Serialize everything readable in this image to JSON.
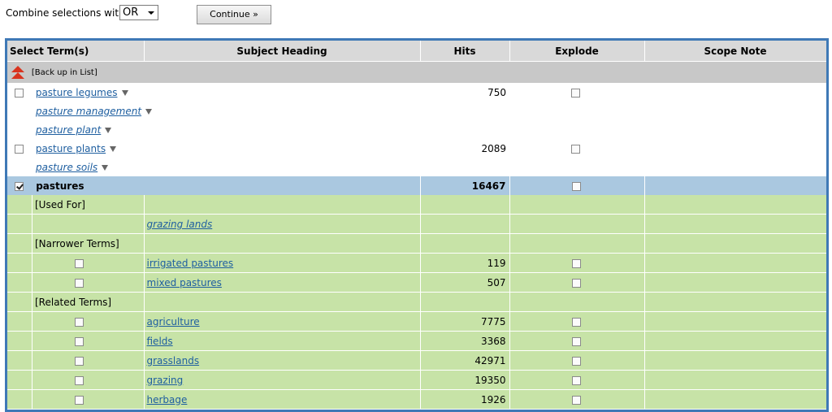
{
  "toolbar": {
    "combine_label": "Combine selections with:",
    "combine_value": "OR",
    "continue_label": "Continue »"
  },
  "table": {
    "headers": [
      "Select Term(s)",
      "Subject Heading",
      "Hits",
      "Explode",
      "Scope Note"
    ],
    "back_up_label": "[Back up in List]",
    "top_rows": [
      {
        "term": "pasture legumes",
        "hits": "750",
        "checkbox": true,
        "italic": false
      },
      {
        "term": "pasture management",
        "hits": "",
        "checkbox": false,
        "italic": true
      },
      {
        "term": "pasture plant",
        "hits": "",
        "checkbox": false,
        "italic": true
      },
      {
        "term": "pasture plants",
        "hits": "2089",
        "checkbox": true,
        "italic": false
      },
      {
        "term": "pasture soils",
        "hits": "",
        "checkbox": false,
        "italic": true
      }
    ],
    "selected_row": {
      "term": "pastures",
      "hits": "16467",
      "checked": true
    },
    "used_for_label": "[Used For]",
    "used_for": [
      {
        "term": "grazing lands"
      }
    ],
    "narrower_label": "[Narrower Terms]",
    "narrower": [
      {
        "term": "irrigated pastures",
        "hits": "119"
      },
      {
        "term": "mixed pastures",
        "hits": "507"
      }
    ],
    "related_label": "[Related Terms]",
    "related": [
      {
        "term": "agriculture",
        "hits": "7775"
      },
      {
        "term": "fields",
        "hits": "3368"
      },
      {
        "term": "grasslands",
        "hits": "42971"
      },
      {
        "term": "grazing",
        "hits": "19350"
      },
      {
        "term": "herbage",
        "hits": "1926"
      }
    ]
  }
}
